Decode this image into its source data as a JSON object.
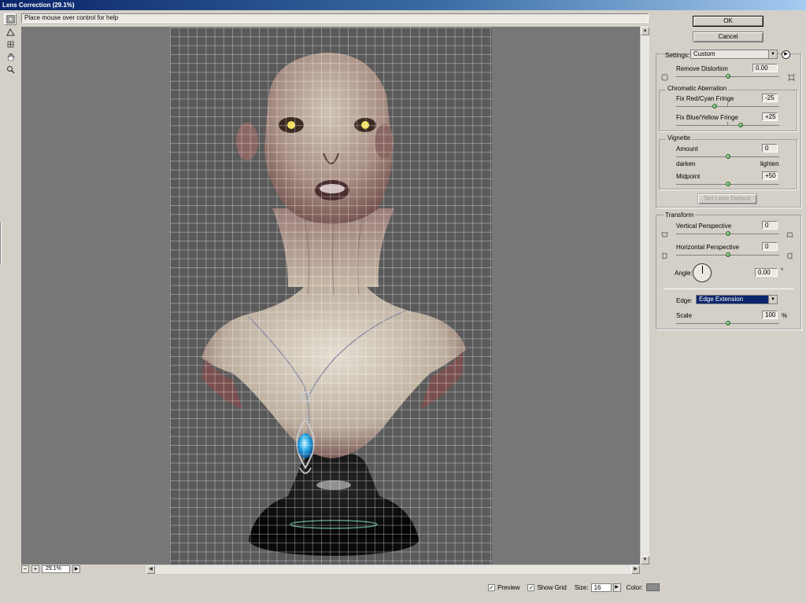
{
  "window": {
    "title": "Lens Correction (29.1%)"
  },
  "help_text": "Place mouse over control for help",
  "tools": [
    {
      "name": "remove-distortion-tool-icon"
    },
    {
      "name": "straighten-tool-icon"
    },
    {
      "name": "move-grid-tool-icon"
    },
    {
      "name": "hand-tool-icon"
    },
    {
      "name": "zoom-tool-icon"
    }
  ],
  "zoom": {
    "minus": "−",
    "plus": "+",
    "value": "29.1%"
  },
  "bottom": {
    "preview_label": "Preview",
    "preview_checked": true,
    "show_grid_label": "Show Grid",
    "show_grid_checked": true,
    "size_label": "Size:",
    "size_value": "16",
    "color_label": "Color:",
    "grid_color": "#8a8a8a"
  },
  "buttons": {
    "ok": "OK",
    "cancel": "Cancel",
    "set_lens_default": "Set Lens Default"
  },
  "settings": {
    "label": "Settings:",
    "value": "Custom",
    "remove_distortion": {
      "label": "Remove Distortion",
      "value": "0.00",
      "slider_pos": 0.5
    }
  },
  "chromatic": {
    "title": "Chromatic Aberration",
    "red_cyan": {
      "label": "Fix Red/Cyan Fringe",
      "value": "-25",
      "slider_pos": 0.375
    },
    "blue_yellow": {
      "label": "Fix Blue/Yellow Fringe",
      "value": "+25",
      "slider_pos": 0.625
    }
  },
  "vignette": {
    "title": "Vignette",
    "amount": {
      "label": "Amount",
      "value": "0",
      "slider_pos": 0.5
    },
    "darken": "darken",
    "lighten": "lighten",
    "midpoint": {
      "label": "Midpoint",
      "value": "+50",
      "slider_pos": 0.5
    }
  },
  "transform": {
    "title": "Transform",
    "vertical": {
      "label": "Vertical Perspective",
      "value": "0",
      "slider_pos": 0.5
    },
    "horizontal": {
      "label": "Horizontal Perspective",
      "value": "0",
      "slider_pos": 0.5
    },
    "angle": {
      "label": "Angle:",
      "value": "0.00",
      "unit": "°"
    },
    "edge": {
      "label": "Edge:",
      "value": "Edge Extension"
    },
    "scale": {
      "label": "Scale",
      "value": "100",
      "unit": "%",
      "slider_pos": 0.5
    }
  }
}
